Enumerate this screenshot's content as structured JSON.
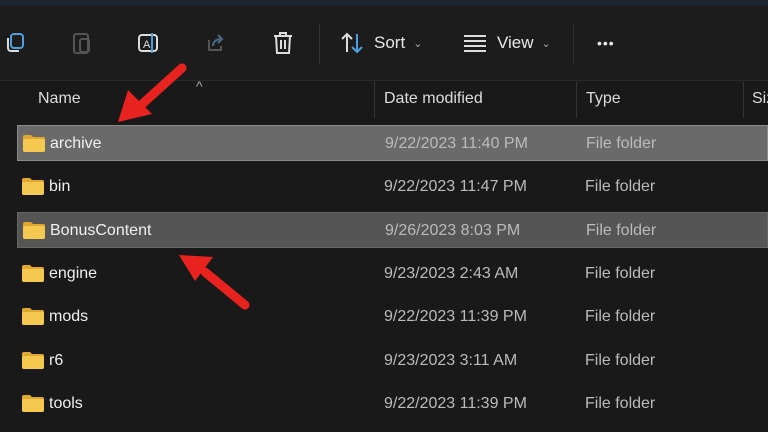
{
  "toolbar": {
    "icons": [
      "copy-icon",
      "paste-icon",
      "rename-icon",
      "share-icon",
      "delete-icon"
    ],
    "sort_label": "Sort",
    "view_label": "View",
    "more_label": "•••"
  },
  "columns": {
    "name": "Name",
    "date": "Date modified",
    "type": "Type",
    "size": "Size"
  },
  "rows": [
    {
      "name": "archive",
      "date": "9/22/2023 11:40 PM",
      "type": "File folder"
    },
    {
      "name": "bin",
      "date": "9/22/2023 11:47 PM",
      "type": "File folder"
    },
    {
      "name": "BonusContent",
      "date": "9/26/2023 8:03 PM",
      "type": "File folder"
    },
    {
      "name": "engine",
      "date": "9/23/2023 2:43 AM",
      "type": "File folder"
    },
    {
      "name": "mods",
      "date": "9/22/2023 11:39 PM",
      "type": "File folder"
    },
    {
      "name": "r6",
      "date": "9/23/2023 3:11 AM",
      "type": "File folder"
    },
    {
      "name": "tools",
      "date": "9/22/2023 11:39 PM",
      "type": "File folder"
    }
  ],
  "colors": {
    "folder": "#f2c14e",
    "arrow": "#e8231f",
    "accent": "#4ca0e0"
  }
}
